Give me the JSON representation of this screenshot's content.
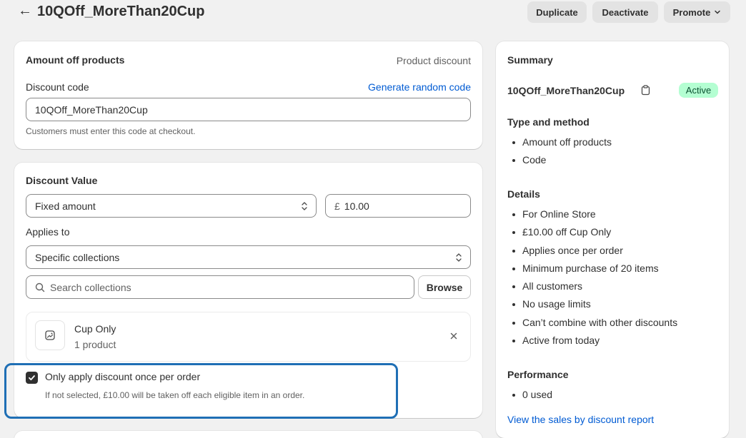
{
  "header": {
    "title": "10QOff_MoreThan20Cup",
    "duplicate_label": "Duplicate",
    "deactivate_label": "Deactivate",
    "promote_label": "Promote"
  },
  "discount_card": {
    "title": "Amount off products",
    "type_label": "Product discount",
    "code_label": "Discount code",
    "generate_label": "Generate random code",
    "code_value": "10QOff_MoreThan20Cup",
    "help": "Customers must enter this code at checkout."
  },
  "value_card": {
    "title": "Discount Value",
    "value_type": "Fixed amount",
    "currency_symbol": "£",
    "amount": "10.00",
    "applies_to_label": "Applies to",
    "applies_to_value": "Specific collections",
    "search_placeholder": "Search collections",
    "browse_label": "Browse",
    "collection": {
      "name": "Cup Only",
      "count": "1 product"
    },
    "once_per_order_label": "Only apply discount once per order",
    "once_per_order_checked": true,
    "once_per_order_help": "If not selected, £10.00 will be taken off each eligible item in an order."
  },
  "summary": {
    "title": "Summary",
    "code": "10QOff_MoreThan20Cup",
    "status": "Active",
    "type_heading": "Type and method",
    "type_items": [
      "Amount off products",
      "Code"
    ],
    "details_heading": "Details",
    "details_items": [
      "For Online Store",
      "£10.00 off Cup Only",
      "Applies once per order",
      "Minimum purchase of 20 items",
      "All customers",
      "No usage limits",
      "Can’t combine with other discounts",
      "Active from today"
    ],
    "performance_heading": "Performance",
    "performance_items": [
      "0 used"
    ],
    "report_link": "View the sales by discount report"
  },
  "colors": {
    "link": "#005bd3",
    "active_badge_bg": "#b4fed2",
    "highlight_border": "#1f6fb5"
  }
}
